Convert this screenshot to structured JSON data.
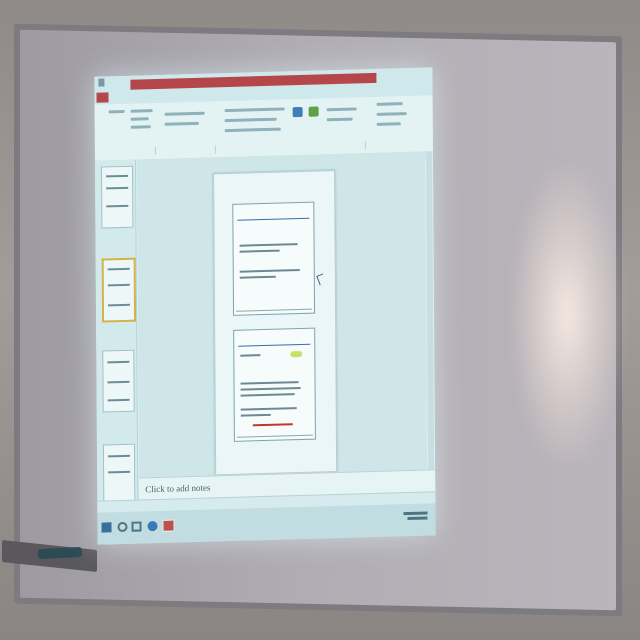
{
  "scene": {
    "description_icons": [
      "whiteboard",
      "projected-powerpoint-window",
      "eraser-marker"
    ]
  },
  "powerpoint": {
    "notes_placeholder": "Click to add notes",
    "page": {
      "slide1_title": "",
      "slide2_title": ""
    }
  },
  "colors": {
    "titlebar": "#b5474a",
    "screen": "#d8eef0",
    "board": "#b1adb4"
  }
}
